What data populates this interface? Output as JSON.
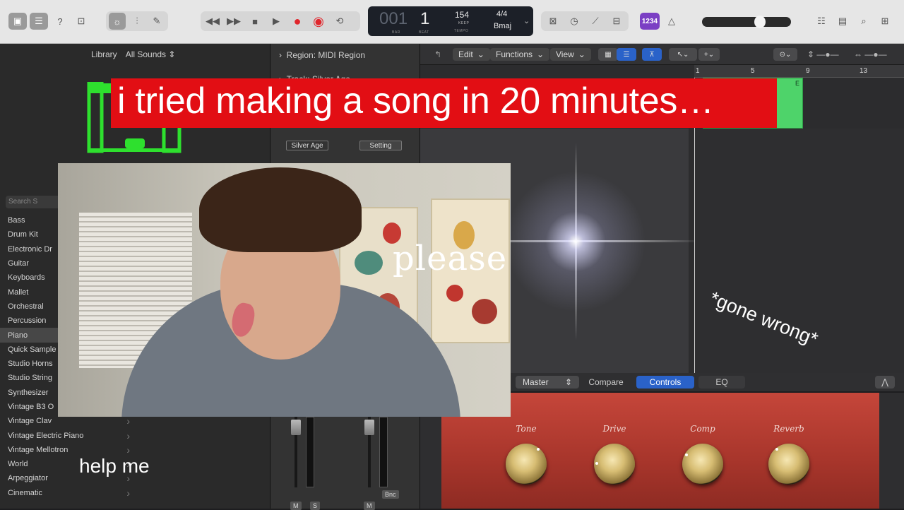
{
  "toolbar": {
    "lcd": {
      "bar": "001",
      "beat": "1",
      "bar_caption": "BAR",
      "beat_caption": "BEAT",
      "tempo": "154",
      "tempo_mode": "KEEP",
      "tempo_caption": "TEMPO",
      "time_signature": "4/4",
      "key": "Bmaj"
    },
    "count_in_badge": "1234",
    "master_volume_level": 0.67
  },
  "library": {
    "title": "Library",
    "filter": "All Sounds ⇕",
    "search_placeholder": "Search S",
    "items": [
      {
        "label": "Bass",
        "has_submenu": false,
        "selected": false
      },
      {
        "label": "Drum Kit",
        "has_submenu": false,
        "selected": false
      },
      {
        "label": "Electronic Dr",
        "has_submenu": false,
        "selected": false
      },
      {
        "label": "Guitar",
        "has_submenu": false,
        "selected": false
      },
      {
        "label": "Keyboards",
        "has_submenu": false,
        "selected": false
      },
      {
        "label": "Mallet",
        "has_submenu": false,
        "selected": false
      },
      {
        "label": "Orchestral",
        "has_submenu": false,
        "selected": false
      },
      {
        "label": "Percussion",
        "has_submenu": false,
        "selected": false
      },
      {
        "label": "Piano",
        "has_submenu": false,
        "selected": true
      },
      {
        "label": "Quick Sample",
        "has_submenu": false,
        "selected": false
      },
      {
        "label": "Studio Horns",
        "has_submenu": false,
        "selected": false
      },
      {
        "label": "Studio String",
        "has_submenu": false,
        "selected": false
      },
      {
        "label": "Synthesizer",
        "has_submenu": false,
        "selected": false
      },
      {
        "label": "Vintage B3 O",
        "has_submenu": false,
        "selected": false
      },
      {
        "label": "Vintage Clav",
        "has_submenu": true,
        "selected": false
      },
      {
        "label": "Vintage Electric Piano",
        "has_submenu": true,
        "selected": false
      },
      {
        "label": "Vintage Mellotron",
        "has_submenu": true,
        "selected": false
      },
      {
        "label": "World",
        "has_submenu": true,
        "selected": false
      },
      {
        "label": "Arpeggiator",
        "has_submenu": true,
        "selected": false
      },
      {
        "label": "Cinematic",
        "has_submenu": true,
        "selected": false
      }
    ]
  },
  "inspector": {
    "region": "Region: MIDI Region",
    "track": "Track: Silver Age",
    "strip_name": "Silver Age",
    "strip_setting": "Setting",
    "bnc": "Bnc",
    "mute_label": "M",
    "solo_label": "S"
  },
  "tracks": {
    "menus": [
      "Edit",
      "Functions",
      "View"
    ],
    "ruler_marks": [
      "1",
      "5",
      "9",
      "13"
    ],
    "region_letter": "E"
  },
  "plugin": {
    "preset": "Master",
    "tabs": [
      "Compare",
      "Controls",
      "EQ"
    ],
    "active_tab": "Controls",
    "knobs": [
      "Tone",
      "Drive",
      "Comp",
      "Reverb"
    ]
  },
  "overlays": {
    "title": "i tried making a song in 20 minutes…",
    "webcam_caption": "please",
    "subtitle": "*gone wrong*",
    "help": "help me"
  },
  "colors": {
    "banner": "#e20e14",
    "region": "#4ed36a",
    "accent_blue": "#2a62c9",
    "record": "#e0262c",
    "plugin_red": "#b23a2f"
  }
}
